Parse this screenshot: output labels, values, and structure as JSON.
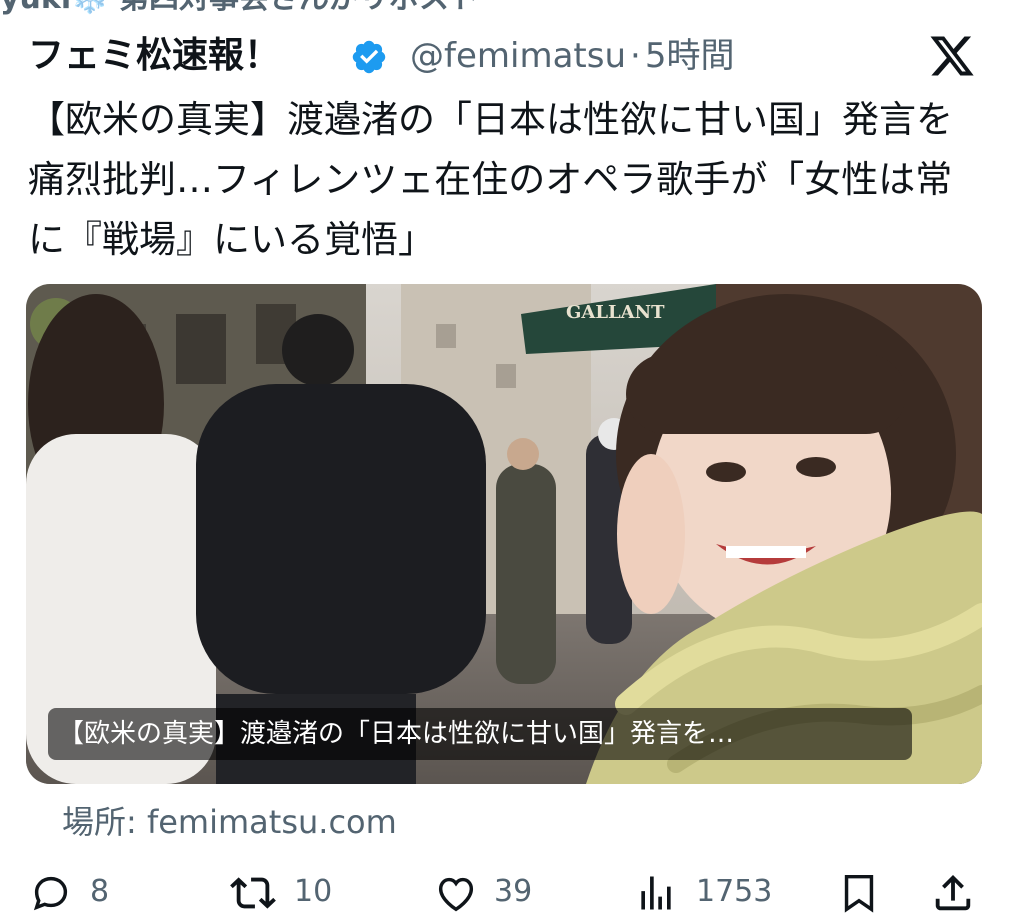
{
  "repost_header": "yuki❄️ 第四対事会さんがリポスト",
  "tweet": {
    "author_name": "フェミ松速報！",
    "handle": "@femimatsu",
    "separator": "·",
    "timestamp": "5時間",
    "text": "【欧米の真実】渡邉渚の「日本は性欲に甘い国」発言を痛烈批判…フィレンツェ在住のオペラ歌手が「女性は常に『戦場』にいる覚悟」"
  },
  "card": {
    "overlay_text": "【欧米の真実】渡邉渚の「日本は性欲に甘い国」発言を…",
    "sign_text": "GALLANT",
    "source_prefix": "場所:",
    "source_domain": "femimatsu.com"
  },
  "actions": {
    "reply_count": "8",
    "repost_count": "10",
    "like_count": "39",
    "view_count": "1753"
  },
  "icons": [
    "verified-badge-icon",
    "x-logo-icon",
    "reply-icon",
    "repost-icon",
    "like-icon",
    "views-icon",
    "bookmark-icon",
    "share-icon"
  ],
  "colors": {
    "text_primary": "#0f1419",
    "text_secondary": "#536471",
    "verified_blue": "#1d9bf0"
  }
}
